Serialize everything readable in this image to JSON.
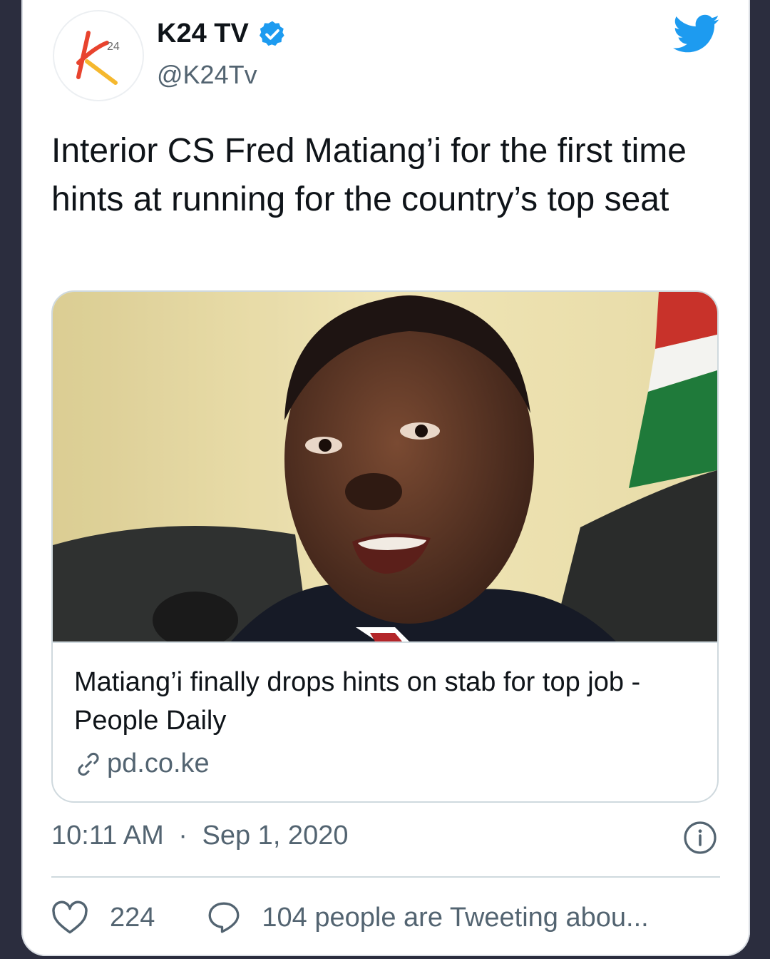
{
  "account": {
    "name": "K24 TV",
    "handle": "@K24Tv",
    "verified": true,
    "avatar_brand": "K24"
  },
  "tweet": {
    "text": "Interior CS Fred Matiang’i for the first time hints at running for the country’s top seat",
    "time": "10:11 AM",
    "separator": "·",
    "date": "Sep 1, 2020"
  },
  "link_card": {
    "title": "Matiang’i finally drops hints on stab for top job - People Daily",
    "domain": "pd.co.ke"
  },
  "engagement": {
    "likes": "224",
    "conversation": "104 people are Tweeting abou..."
  },
  "icons": {
    "brand": "twitter-bird-icon",
    "verified": "verified-badge-icon",
    "link": "link-icon",
    "info": "info-icon",
    "like": "heart-icon",
    "reply": "speech-bubble-icon"
  },
  "colors": {
    "twitter_blue": "#1d9bf0",
    "text_primary": "#0f1419",
    "text_secondary": "#536471",
    "background": "#2b2d3e"
  }
}
